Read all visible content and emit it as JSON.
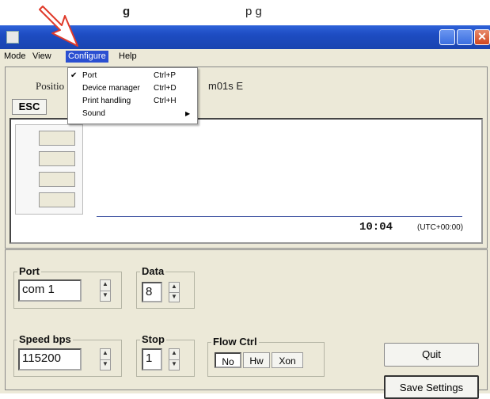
{
  "caption": {
    "left_fragment": "g",
    "right_fragment": "p      g"
  },
  "window": {
    "close_glyph": "✕",
    "menus": [
      "Mode",
      "View",
      "Configure",
      "Help"
    ],
    "active_menu": "Configure"
  },
  "configure_menu": [
    {
      "checked": true,
      "check_glyph": "✔",
      "label": "Port",
      "shortcut": "Ctrl+P"
    },
    {
      "checked": false,
      "label": "Device manager",
      "shortcut": "Ctrl+D"
    },
    {
      "checked": false,
      "label": "Print handling",
      "shortcut": "Ctrl+H"
    },
    {
      "checked": false,
      "label": "Sound",
      "submenu_arrow": "▶"
    }
  ],
  "status": {
    "position_label": "Positio",
    "coordinate_fragment": "m01s E",
    "esc_label": "ESC",
    "clock": "10:04",
    "timezone": "(UTC+00:00)"
  },
  "settings": {
    "port": {
      "label": "Port",
      "value": "com 1"
    },
    "data": {
      "label": "Data",
      "value": "8"
    },
    "speed": {
      "label": "Speed bps",
      "value": "115200"
    },
    "stop": {
      "label": "Stop",
      "value": "1"
    },
    "flow": {
      "label": "Flow Ctrl",
      "options": [
        "No",
        "Hw",
        "Xon"
      ]
    },
    "quit_label": "Quit",
    "save_label": "Save Settings"
  },
  "spin_glyphs": {
    "up": "▲",
    "down": "▼"
  },
  "colors": {
    "titlebar": "#1d4cc2",
    "menu_highlight": "#2a4fd1",
    "annotation_arrow": "#e03a2a"
  }
}
